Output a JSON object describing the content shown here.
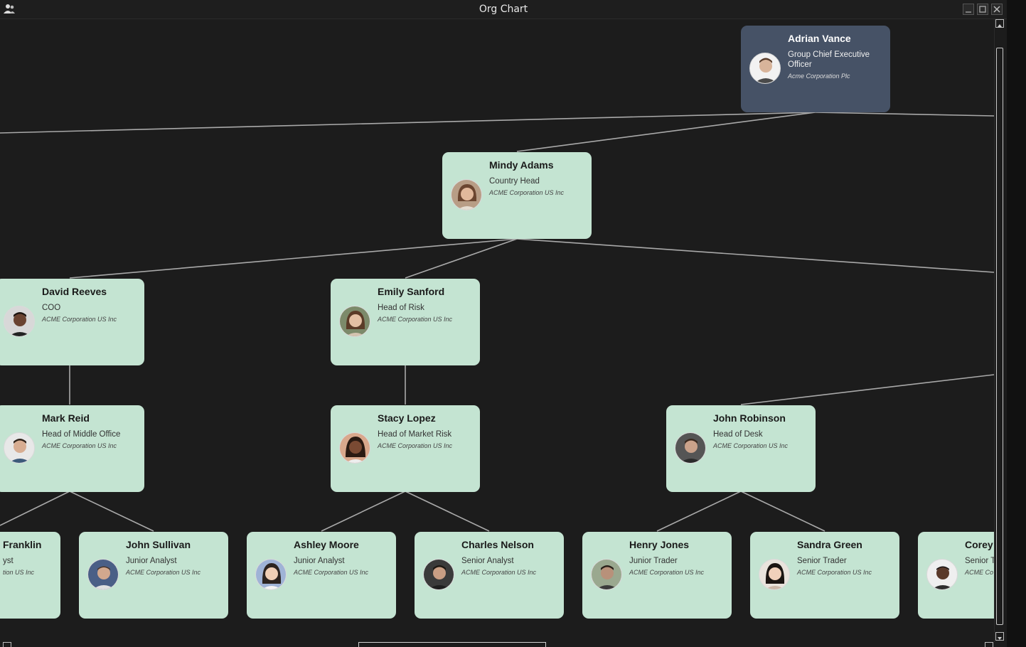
{
  "window": {
    "title": "Org Chart"
  },
  "icons": {
    "app": "people-icon",
    "minimize": "minimize-icon",
    "maximize": "maximize-icon",
    "close": "close-icon",
    "scroll_up": "arrow-up-icon",
    "scroll_down": "arrow-down-icon",
    "scroll_left": "arrow-left-icon",
    "scroll_right": "arrow-right-icon"
  },
  "colors": {
    "background": "#1c1c1c",
    "node_fill": "#c4e4d2",
    "root_fill": "#465266",
    "connector": "#a9a9a9"
  },
  "nodes": {
    "adrian": {
      "name": "Adrian Vance",
      "role": "Group Chief Executive Officer",
      "company": "Acme Corporation Plc"
    },
    "mindy": {
      "name": "Mindy Adams",
      "role": "Country Head",
      "company": "ACME Corporation US Inc"
    },
    "david": {
      "name": "David Reeves",
      "role": "COO",
      "company": "ACME Corporation US Inc"
    },
    "emily": {
      "name": "Emily Sanford",
      "role": "Head of Risk",
      "company": "ACME Corporation US Inc"
    },
    "mark": {
      "name": "Mark Reid",
      "role": "Head of Middle Office",
      "company": "ACME Corporation US Inc"
    },
    "stacy": {
      "name": "Stacy Lopez",
      "role": "Head of Market Risk",
      "company": "ACME Corporation US Inc"
    },
    "john_r": {
      "name": "John Robinson",
      "role": "Head of Desk",
      "company": "ACME Corporation US Inc"
    },
    "franklin": {
      "name": "Franklin",
      "role": "yst",
      "company": "tion US Inc"
    },
    "john_s": {
      "name": "John Sullivan",
      "role": "Junior Analyst",
      "company": "ACME Corporation US Inc"
    },
    "ashley": {
      "name": "Ashley Moore",
      "role": "Junior Analyst",
      "company": "ACME Corporation US Inc"
    },
    "charles": {
      "name": "Charles Nelson",
      "role": "Senior Analyst",
      "company": "ACME Corporation US Inc"
    },
    "henry": {
      "name": "Henry Jones",
      "role": "Junior Trader",
      "company": "ACME Corporation US Inc"
    },
    "sandra": {
      "name": "Sandra Green",
      "role": "Senior Trader",
      "company": "ACME Corporation US Inc"
    },
    "corey": {
      "name": "Corey",
      "role": "Senior T",
      "company": "ACME Co"
    }
  }
}
